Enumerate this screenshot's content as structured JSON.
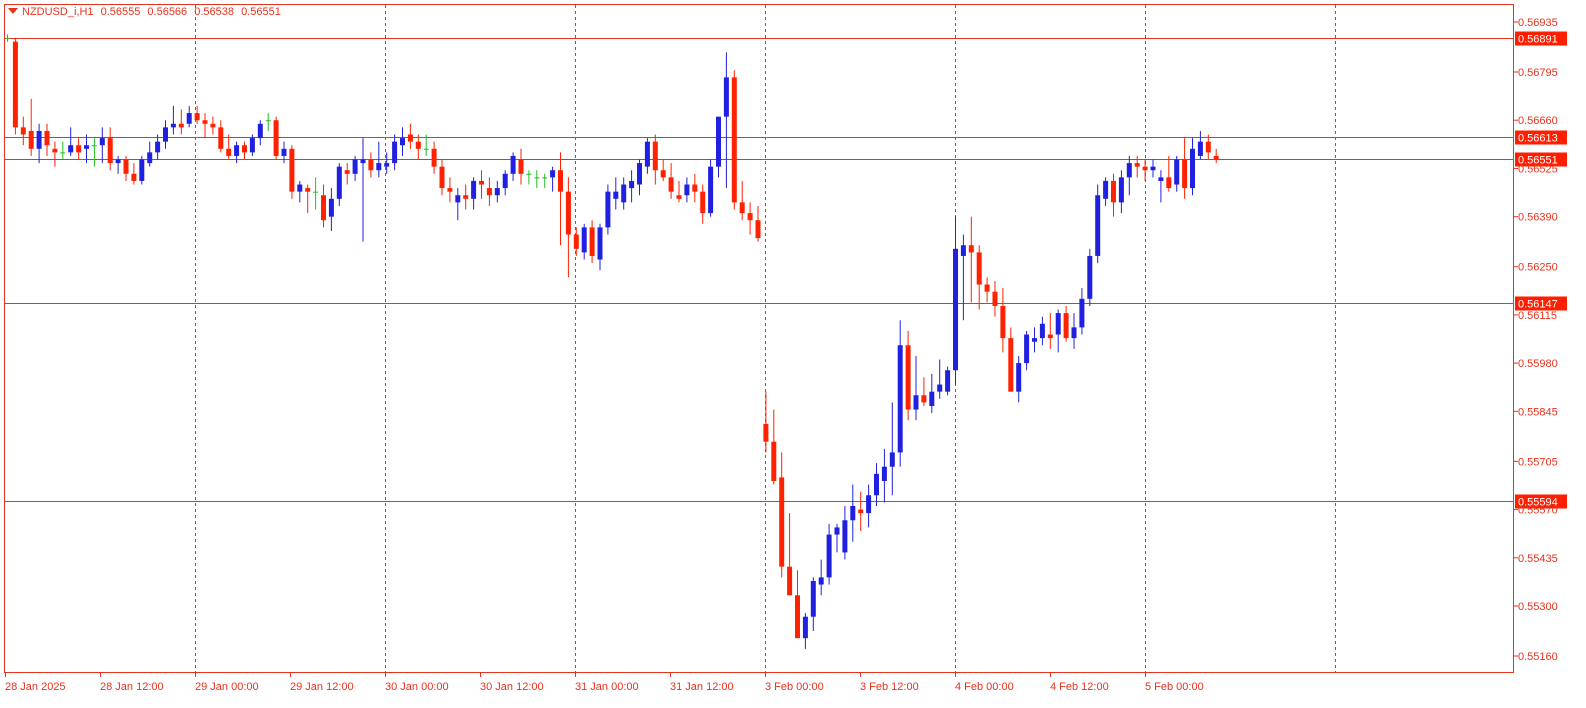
{
  "header": {
    "symbol": "NZDUSD_i,H1",
    "open": "0.56555",
    "high": "0.56566",
    "low": "0.56538",
    "close": "0.56551"
  },
  "colors": {
    "background": "#ffffff",
    "frame": "#e8321e",
    "axis_text": "#e8321e",
    "grid": "#e8321e",
    "bull": "#2020e0",
    "bear": "#ff2200",
    "doji": "#20c020",
    "hline": "#e8321e",
    "hline_label_bg": "#ff1e00",
    "hline_label_text": "#ffffff"
  },
  "chart_data": {
    "type": "candlestick",
    "title": "NZDUSD_i,H1",
    "timeframe": "H1",
    "y_ticks": [
      "0.56935",
      "0.56795",
      "0.56660",
      "0.56525",
      "0.56390",
      "0.56250",
      "0.56115",
      "0.55980",
      "0.55845",
      "0.55705",
      "0.55570",
      "0.55435",
      "0.55300",
      "0.55160"
    ],
    "ylim": [
      0.551,
      0.5697
    ],
    "x_labels": [
      "28 Jan 2025",
      "28 Jan 12:00",
      "29 Jan 00:00",
      "29 Jan 12:00",
      "30 Jan 00:00",
      "30 Jan 12:00",
      "31 Jan 00:00",
      "31 Jan 12:00",
      "3 Feb 00:00",
      "3 Feb 12:00",
      "4 Feb 00:00",
      "4 Feb 12:00",
      "5 Feb 00:00"
    ],
    "grid": "vertical dotted at every 12 hours",
    "horizontal_lines": [
      {
        "label": "0.56891",
        "value": 0.56891
      },
      {
        "label": "0.56613",
        "value": 0.56613
      },
      {
        "label": "0.56551",
        "value": 0.56551
      },
      {
        "label": "0.56147",
        "value": 0.56147
      },
      {
        "label": "0.55594",
        "value": 0.55594
      }
    ],
    "candles": [
      [
        0.5689,
        0.569,
        0.5688,
        0.5689
      ],
      [
        0.5688,
        0.5689,
        0.5662,
        0.5664
      ],
      [
        0.5664,
        0.5667,
        0.5659,
        0.5662
      ],
      [
        0.5663,
        0.5672,
        0.5656,
        0.5658
      ],
      [
        0.5658,
        0.5665,
        0.5654,
        0.5663
      ],
      [
        0.5663,
        0.5665,
        0.5656,
        0.5659
      ],
      [
        0.5658,
        0.566,
        0.5653,
        0.5657
      ],
      [
        0.5657,
        0.566,
        0.5655,
        0.5657
      ],
      [
        0.5657,
        0.5664,
        0.5656,
        0.5659
      ],
      [
        0.5659,
        0.5661,
        0.5655,
        0.5657
      ],
      [
        0.5658,
        0.5662,
        0.5654,
        0.5659
      ],
      [
        0.5659,
        0.5661,
        0.5653,
        0.5659
      ],
      [
        0.5659,
        0.5664,
        0.5654,
        0.5661
      ],
      [
        0.5661,
        0.5664,
        0.5652,
        0.5654
      ],
      [
        0.5654,
        0.5656,
        0.5651,
        0.5655
      ],
      [
        0.5655,
        0.5656,
        0.5649,
        0.5651
      ],
      [
        0.5651,
        0.5654,
        0.5648,
        0.5649
      ],
      [
        0.5649,
        0.5656,
        0.5648,
        0.5655
      ],
      [
        0.5654,
        0.566,
        0.5653,
        0.5657
      ],
      [
        0.5657,
        0.5662,
        0.5655,
        0.566
      ],
      [
        0.566,
        0.5666,
        0.5658,
        0.5664
      ],
      [
        0.5664,
        0.567,
        0.5662,
        0.5665
      ],
      [
        0.5665,
        0.5669,
        0.5662,
        0.5664
      ],
      [
        0.5665,
        0.567,
        0.5664,
        0.5668
      ],
      [
        0.5668,
        0.567,
        0.5665,
        0.5666
      ],
      [
        0.5666,
        0.5668,
        0.5661,
        0.5665
      ],
      [
        0.5665,
        0.5667,
        0.5662,
        0.5664
      ],
      [
        0.5664,
        0.5666,
        0.5657,
        0.5658
      ],
      [
        0.5658,
        0.5662,
        0.5655,
        0.5656
      ],
      [
        0.5656,
        0.566,
        0.5654,
        0.5659
      ],
      [
        0.5659,
        0.566,
        0.5655,
        0.5657
      ],
      [
        0.5657,
        0.5662,
        0.5656,
        0.5661
      ],
      [
        0.5661,
        0.5666,
        0.5659,
        0.5665
      ],
      [
        0.5666,
        0.5668,
        0.5663,
        0.5666
      ],
      [
        0.5666,
        0.5667,
        0.5655,
        0.5656
      ],
      [
        0.5656,
        0.566,
        0.5654,
        0.5658
      ],
      [
        0.5658,
        0.5659,
        0.5644,
        0.5646
      ],
      [
        0.5646,
        0.5649,
        0.5643,
        0.5648
      ],
      [
        0.5647,
        0.5648,
        0.564,
        0.5646
      ],
      [
        0.5646,
        0.565,
        0.5641,
        0.5646
      ],
      [
        0.5645,
        0.5648,
        0.5636,
        0.5638
      ],
      [
        0.5639,
        0.5647,
        0.5635,
        0.5644
      ],
      [
        0.5644,
        0.5654,
        0.5642,
        0.5653
      ],
      [
        0.5652,
        0.5654,
        0.5648,
        0.5651
      ],
      [
        0.5651,
        0.5656,
        0.5649,
        0.5655
      ],
      [
        0.5654,
        0.5661,
        0.5632,
        0.5655
      ],
      [
        0.5655,
        0.5657,
        0.565,
        0.5652
      ],
      [
        0.5652,
        0.566,
        0.565,
        0.5654
      ],
      [
        0.5653,
        0.5657,
        0.5651,
        0.5654
      ],
      [
        0.5654,
        0.5662,
        0.5652,
        0.566
      ],
      [
        0.5659,
        0.5664,
        0.5656,
        0.5661
      ],
      [
        0.5662,
        0.5665,
        0.5658,
        0.566
      ],
      [
        0.566,
        0.5662,
        0.5655,
        0.5658
      ],
      [
        0.5658,
        0.5662,
        0.5656,
        0.5658
      ],
      [
        0.5658,
        0.566,
        0.5651,
        0.5653
      ],
      [
        0.5653,
        0.5655,
        0.5645,
        0.5647
      ],
      [
        0.5647,
        0.565,
        0.5643,
        0.5646
      ],
      [
        0.5643,
        0.5647,
        0.5638,
        0.5645
      ],
      [
        0.5645,
        0.5648,
        0.5641,
        0.5644
      ],
      [
        0.5644,
        0.565,
        0.5641,
        0.5649
      ],
      [
        0.5649,
        0.5652,
        0.5644,
        0.5648
      ],
      [
        0.5647,
        0.565,
        0.5642,
        0.5645
      ],
      [
        0.5645,
        0.5649,
        0.5643,
        0.5647
      ],
      [
        0.5647,
        0.5652,
        0.5645,
        0.5651
      ],
      [
        0.5651,
        0.5657,
        0.5649,
        0.5656
      ],
      [
        0.5655,
        0.5658,
        0.5648,
        0.5651
      ],
      [
        0.5651,
        0.5652,
        0.5648,
        0.5651
      ],
      [
        0.565,
        0.5652,
        0.5647,
        0.565
      ],
      [
        0.565,
        0.5651,
        0.5647,
        0.565
      ],
      [
        0.565,
        0.5653,
        0.5646,
        0.5652
      ],
      [
        0.5652,
        0.5657,
        0.5631,
        0.5646
      ],
      [
        0.5646,
        0.565,
        0.5622,
        0.5634
      ],
      [
        0.5634,
        0.5636,
        0.5628,
        0.563
      ],
      [
        0.5629,
        0.5637,
        0.5627,
        0.5636
      ],
      [
        0.5636,
        0.5638,
        0.5626,
        0.5628
      ],
      [
        0.5627,
        0.5637,
        0.5624,
        0.5636
      ],
      [
        0.5636,
        0.5648,
        0.5634,
        0.5646
      ],
      [
        0.5644,
        0.565,
        0.5641,
        0.5646
      ],
      [
        0.5643,
        0.565,
        0.5641,
        0.5648
      ],
      [
        0.5647,
        0.5652,
        0.5643,
        0.5649
      ],
      [
        0.5648,
        0.5655,
        0.5645,
        0.5654
      ],
      [
        0.5653,
        0.5661,
        0.5651,
        0.566
      ],
      [
        0.566,
        0.5662,
        0.5648,
        0.5652
      ],
      [
        0.5652,
        0.5655,
        0.5649,
        0.565
      ],
      [
        0.565,
        0.5654,
        0.5644,
        0.5646
      ],
      [
        0.5645,
        0.5649,
        0.5643,
        0.5644
      ],
      [
        0.5645,
        0.565,
        0.5643,
        0.5648
      ],
      [
        0.5648,
        0.5651,
        0.5643,
        0.5646
      ],
      [
        0.5646,
        0.5648,
        0.5637,
        0.564
      ],
      [
        0.564,
        0.5655,
        0.5639,
        0.5653
      ],
      [
        0.5653,
        0.5665,
        0.565,
        0.5667
      ],
      [
        0.5667,
        0.5685,
        0.5647,
        0.5678
      ],
      [
        0.5678,
        0.568,
        0.5641,
        0.5643
      ],
      [
        0.5643,
        0.5649,
        0.5638,
        0.564
      ],
      [
        0.564,
        0.5643,
        0.5634,
        0.5638
      ],
      [
        0.5638,
        0.5642,
        0.5632,
        0.5633
      ],
      [
        0.5581,
        0.559,
        0.5573,
        0.5576
      ],
      [
        0.5576,
        0.5585,
        0.5564,
        0.5565
      ],
      [
        0.5566,
        0.5573,
        0.5538,
        0.5541
      ],
      [
        0.5541,
        0.5556,
        0.5534,
        0.5533
      ],
      [
        0.5533,
        0.554,
        0.5528,
        0.5521
      ],
      [
        0.5521,
        0.5528,
        0.5518,
        0.5527
      ],
      [
        0.5527,
        0.5538,
        0.5523,
        0.5537
      ],
      [
        0.5536,
        0.5543,
        0.5533,
        0.5538
      ],
      [
        0.5538,
        0.5553,
        0.5536,
        0.555
      ],
      [
        0.555,
        0.5553,
        0.5545,
        0.5552
      ],
      [
        0.5545,
        0.5558,
        0.5543,
        0.5554
      ],
      [
        0.5554,
        0.5564,
        0.5548,
        0.5558
      ],
      [
        0.5557,
        0.5562,
        0.5551,
        0.5556
      ],
      [
        0.5556,
        0.5564,
        0.5552,
        0.5561
      ],
      [
        0.5561,
        0.557,
        0.5558,
        0.5567
      ],
      [
        0.5565,
        0.5574,
        0.5559,
        0.5569
      ],
      [
        0.5569,
        0.5587,
        0.5561,
        0.5573
      ],
      [
        0.5573,
        0.561,
        0.5569,
        0.5603
      ],
      [
        0.5603,
        0.5607,
        0.5582,
        0.5585
      ],
      [
        0.5585,
        0.56,
        0.5582,
        0.5589
      ],
      [
        0.5589,
        0.5594,
        0.5586,
        0.5587
      ],
      [
        0.5586,
        0.5595,
        0.5584,
        0.559
      ],
      [
        0.559,
        0.5599,
        0.5588,
        0.5592
      ],
      [
        0.559,
        0.5597,
        0.5589,
        0.5596
      ],
      [
        0.5596,
        0.5639,
        0.5592,
        0.563
      ],
      [
        0.5628,
        0.5634,
        0.561,
        0.5631
      ],
      [
        0.5631,
        0.5639,
        0.5615,
        0.5629
      ],
      [
        0.5629,
        0.5631,
        0.5613,
        0.562
      ],
      [
        0.562,
        0.5622,
        0.5615,
        0.5618
      ],
      [
        0.5618,
        0.5621,
        0.5611,
        0.5614
      ],
      [
        0.5614,
        0.5619,
        0.5601,
        0.5605
      ],
      [
        0.5605,
        0.5608,
        0.5591,
        0.559
      ],
      [
        0.559,
        0.56,
        0.5587,
        0.5598
      ],
      [
        0.5598,
        0.5607,
        0.5596,
        0.5606
      ],
      [
        0.5604,
        0.5608,
        0.5601,
        0.5605
      ],
      [
        0.5605,
        0.5611,
        0.5603,
        0.5609
      ],
      [
        0.5606,
        0.5612,
        0.5602,
        0.5605
      ],
      [
        0.5606,
        0.5613,
        0.5601,
        0.5612
      ],
      [
        0.5612,
        0.5614,
        0.5604,
        0.5605
      ],
      [
        0.5605,
        0.5612,
        0.5602,
        0.5608
      ],
      [
        0.5608,
        0.5619,
        0.5606,
        0.5616
      ],
      [
        0.5616,
        0.563,
        0.5614,
        0.5628
      ],
      [
        0.5628,
        0.5648,
        0.5626,
        0.5645
      ],
      [
        0.5644,
        0.565,
        0.5642,
        0.5649
      ],
      [
        0.5649,
        0.5651,
        0.5639,
        0.5643
      ],
      [
        0.5643,
        0.5652,
        0.564,
        0.565
      ],
      [
        0.565,
        0.5656,
        0.5645,
        0.5654
      ],
      [
        0.5654,
        0.5656,
        0.565,
        0.5653
      ],
      [
        0.5653,
        0.5655,
        0.5649,
        0.5652
      ],
      [
        0.5652,
        0.5655,
        0.565,
        0.5653
      ],
      [
        0.5649,
        0.5652,
        0.5643,
        0.565
      ],
      [
        0.565,
        0.5656,
        0.5646,
        0.5647
      ],
      [
        0.5648,
        0.5656,
        0.5646,
        0.5655
      ],
      [
        0.5655,
        0.5661,
        0.5644,
        0.5647
      ],
      [
        0.5647,
        0.5661,
        0.5645,
        0.5658
      ],
      [
        0.5656,
        0.5663,
        0.5655,
        0.566
      ],
      [
        0.566,
        0.5662,
        0.5655,
        0.5657
      ],
      [
        0.5656,
        0.5658,
        0.5654,
        0.5655
      ]
    ]
  }
}
